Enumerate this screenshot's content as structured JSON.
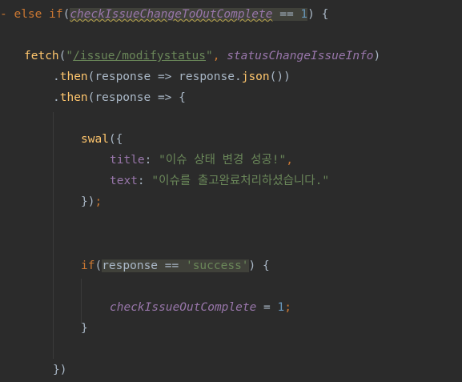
{
  "lines": [
    {
      "indent": 0,
      "tokens": [
        {
          "t": "- ",
          "c": "kw"
        },
        {
          "t": "else if",
          "c": "kw"
        },
        {
          "t": "(",
          "c": ""
        },
        {
          "t": "checkIssueChangeToOutComplete",
          "c": "prop it hl squiggle"
        },
        {
          "t": " == ",
          "c": "hl"
        },
        {
          "t": "1",
          "c": "num hl"
        },
        {
          "t": ") {",
          "c": ""
        }
      ]
    },
    {
      "indent": 0,
      "tokens": []
    },
    {
      "indent": 30,
      "tokens": [
        {
          "t": "fetch",
          "c": "fn"
        },
        {
          "t": "(",
          "c": ""
        },
        {
          "t": "\"",
          "c": "str"
        },
        {
          "t": "/issue/modifystatus",
          "c": "str path"
        },
        {
          "t": "\"",
          "c": "str"
        },
        {
          "t": ", ",
          "c": "kw"
        },
        {
          "t": "statusChangeIssueInfo",
          "c": "prop it"
        },
        {
          "t": ")",
          "c": ""
        }
      ]
    },
    {
      "indent": 66,
      "tokens": [
        {
          "t": ".",
          "c": ""
        },
        {
          "t": "then",
          "c": "fn"
        },
        {
          "t": "(response => response.",
          "c": ""
        },
        {
          "t": "json",
          "c": "fn"
        },
        {
          "t": "())",
          "c": ""
        }
      ]
    },
    {
      "indent": 66,
      "tokens": [
        {
          "t": ".",
          "c": ""
        },
        {
          "t": "then",
          "c": "fn"
        },
        {
          "t": "(response => {",
          "c": ""
        }
      ]
    },
    {
      "indent": 0,
      "tokens": []
    },
    {
      "indent": 101,
      "tokens": [
        {
          "t": "swal",
          "c": "fn"
        },
        {
          "t": "({",
          "c": ""
        }
      ]
    },
    {
      "indent": 137,
      "tokens": [
        {
          "t": "title",
          "c": "prop"
        },
        {
          "t": ": ",
          "c": ""
        },
        {
          "t": "\"이슈 상태 변경 성공!\"",
          "c": "str"
        },
        {
          "t": ",",
          "c": "kw"
        }
      ]
    },
    {
      "indent": 137,
      "tokens": [
        {
          "t": "text",
          "c": "prop"
        },
        {
          "t": ": ",
          "c": ""
        },
        {
          "t": "\"이슈를 출고완료처리하셨습니다.\"",
          "c": "str"
        }
      ]
    },
    {
      "indent": 101,
      "tokens": [
        {
          "t": "})",
          "c": ""
        },
        {
          "t": ";",
          "c": "kw"
        }
      ]
    },
    {
      "indent": 0,
      "tokens": []
    },
    {
      "indent": 0,
      "tokens": []
    },
    {
      "indent": 101,
      "tokens": [
        {
          "t": "if",
          "c": "kw"
        },
        {
          "t": "(",
          "c": ""
        },
        {
          "t": "response == ",
          "c": "hl"
        },
        {
          "t": "'success'",
          "c": "str hl"
        },
        {
          "t": ") {",
          "c": ""
        }
      ]
    },
    {
      "indent": 0,
      "tokens": []
    },
    {
      "indent": 137,
      "tokens": [
        {
          "t": "checkIssueOutComplete",
          "c": "prop it"
        },
        {
          "t": " = ",
          "c": ""
        },
        {
          "t": "1",
          "c": "num"
        },
        {
          "t": ";",
          "c": "kw"
        }
      ]
    },
    {
      "indent": 101,
      "tokens": [
        {
          "t": "}",
          "c": ""
        }
      ]
    },
    {
      "indent": 0,
      "tokens": []
    },
    {
      "indent": 66,
      "tokens": [
        {
          "t": "})",
          "c": ""
        }
      ]
    }
  ]
}
